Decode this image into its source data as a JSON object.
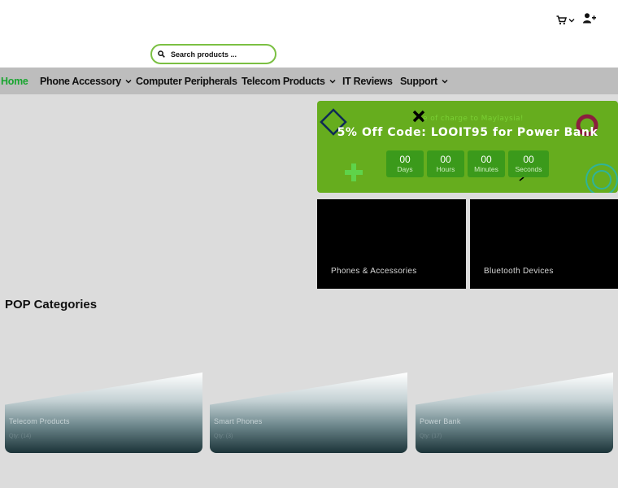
{
  "header": {
    "icons": {
      "cart": "cart-icon",
      "cart_chevron": "chevron-down-icon",
      "account": "user-plus-icon"
    }
  },
  "search": {
    "placeholder": "Search products ...",
    "value": ""
  },
  "nav": {
    "items": [
      {
        "label": "Home",
        "active": true,
        "dropdown": false
      },
      {
        "label": "Phone Accessory",
        "active": false,
        "dropdown": true
      },
      {
        "label": "Computer Peripherals",
        "active": false,
        "dropdown": false
      },
      {
        "label": "Telecom Products",
        "active": false,
        "dropdown": true
      },
      {
        "label": "IT Reviews",
        "active": false,
        "dropdown": false
      },
      {
        "label": "Support",
        "active": false,
        "dropdown": true
      }
    ]
  },
  "promo": {
    "subtitle": "e of charge to Maylaysia!",
    "title": "5% Off Code: LOOIT95 for Power Bank",
    "countdown": [
      {
        "value": "00",
        "unit": "Days"
      },
      {
        "value": "00",
        "unit": "Hours"
      },
      {
        "value": "00",
        "unit": "Minutes"
      },
      {
        "value": "00",
        "unit": "Seconds"
      }
    ],
    "colors": {
      "background": "#66ad1e",
      "box": "#3b9a1b"
    }
  },
  "tiles": [
    {
      "label": "Phones & Accessories"
    },
    {
      "label": "Bluetooth Devices"
    }
  ],
  "categories": {
    "title": "POP Categories",
    "items": [
      {
        "name": "Telecom Products",
        "qty": "Qty: (14)"
      },
      {
        "name": "Smart Phones",
        "qty": "Qty: (3)"
      },
      {
        "name": "Power Bank",
        "qty": "Qty: (17)"
      }
    ]
  },
  "colors": {
    "accent": "#7bc043",
    "nav_active": "#18a52f",
    "nav_bg": "#bdbdbd"
  }
}
